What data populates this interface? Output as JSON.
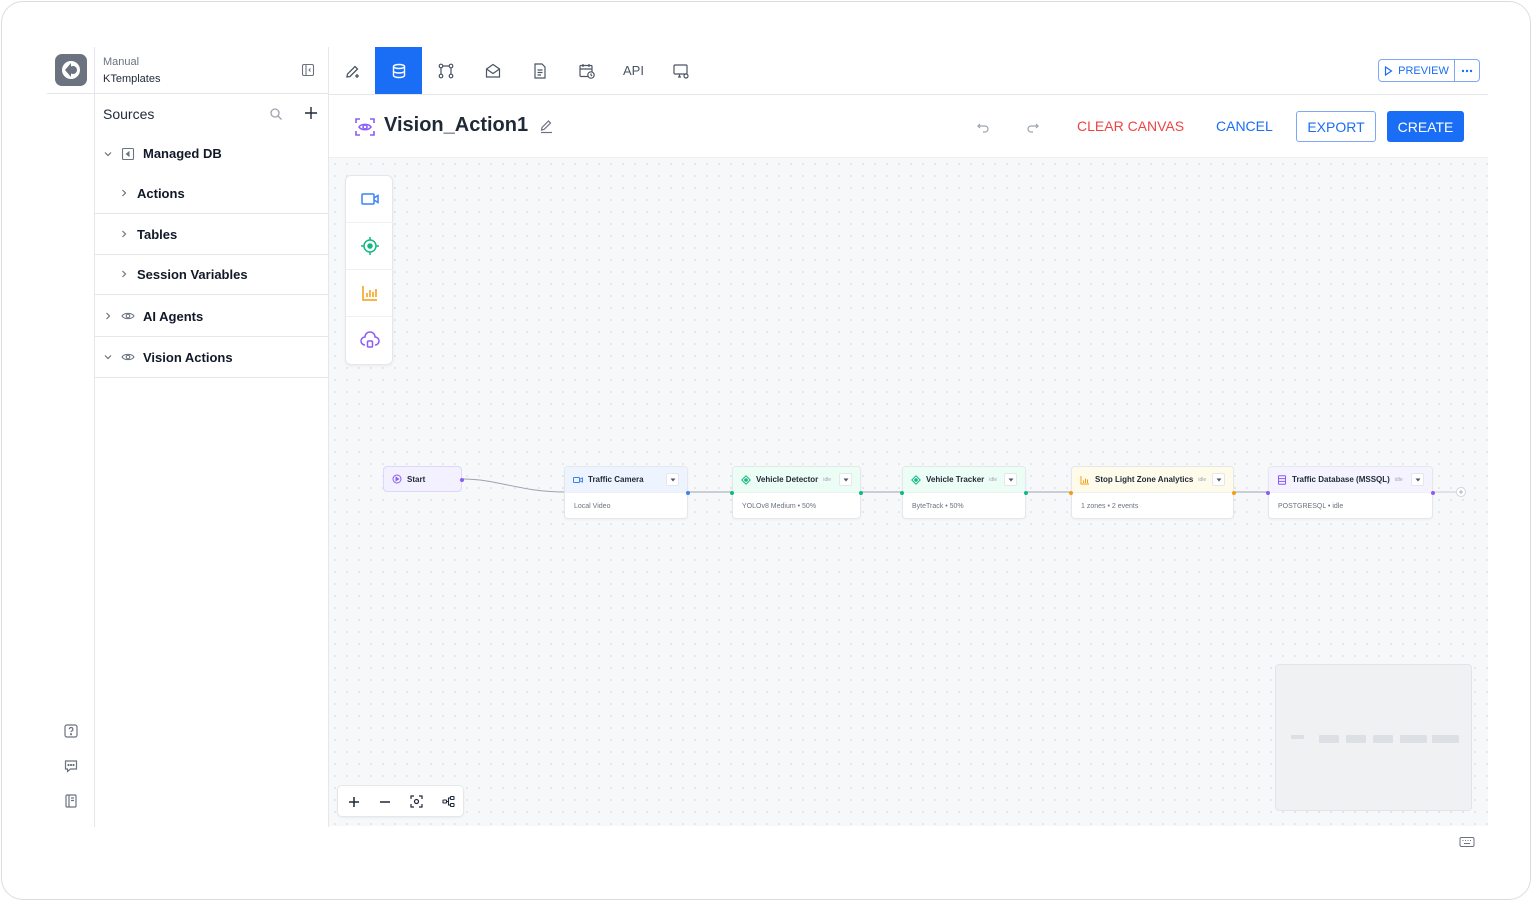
{
  "sidebar": {
    "mode": "Manual",
    "template": "KTemplates",
    "sources_title": "Sources",
    "tree": {
      "managed_db": "Managed DB",
      "actions": "Actions",
      "tables": "Tables",
      "session_variables": "Session Variables",
      "ai_agents": "AI Agents",
      "vision_actions": "Vision Actions"
    }
  },
  "toolbar": {
    "api_label": "API",
    "preview_label": "PREVIEW"
  },
  "action_bar": {
    "title": "Vision_Action1",
    "clear_label": "CLEAR CANVAS",
    "cancel_label": "CANCEL",
    "export_label": "EXPORT",
    "create_label": "CREATE"
  },
  "flow": {
    "start": "Start",
    "nodes": [
      {
        "title": "Traffic Camera",
        "status": "",
        "subtitle": "Local Video"
      },
      {
        "title": "Vehicle Detector",
        "status": "idle",
        "subtitle": "YOLOv8 Medium • 50%"
      },
      {
        "title": "Vehicle Tracker",
        "status": "idle",
        "subtitle": "ByteTrack • 50%"
      },
      {
        "title": "Stop Light Zone Analytics",
        "status": "idle",
        "subtitle": "1 zones • 2 events"
      },
      {
        "title": "Traffic Database (MSSQL)",
        "status": "idle",
        "subtitle": "POSTGRESQL • idle"
      }
    ]
  },
  "colors": {
    "primary": "#1a6ef5",
    "danger": "#ef4444",
    "camera": "#3b82f6",
    "detector": "#10b981",
    "analytics": "#f59e0b",
    "database": "#8b5cf6"
  }
}
